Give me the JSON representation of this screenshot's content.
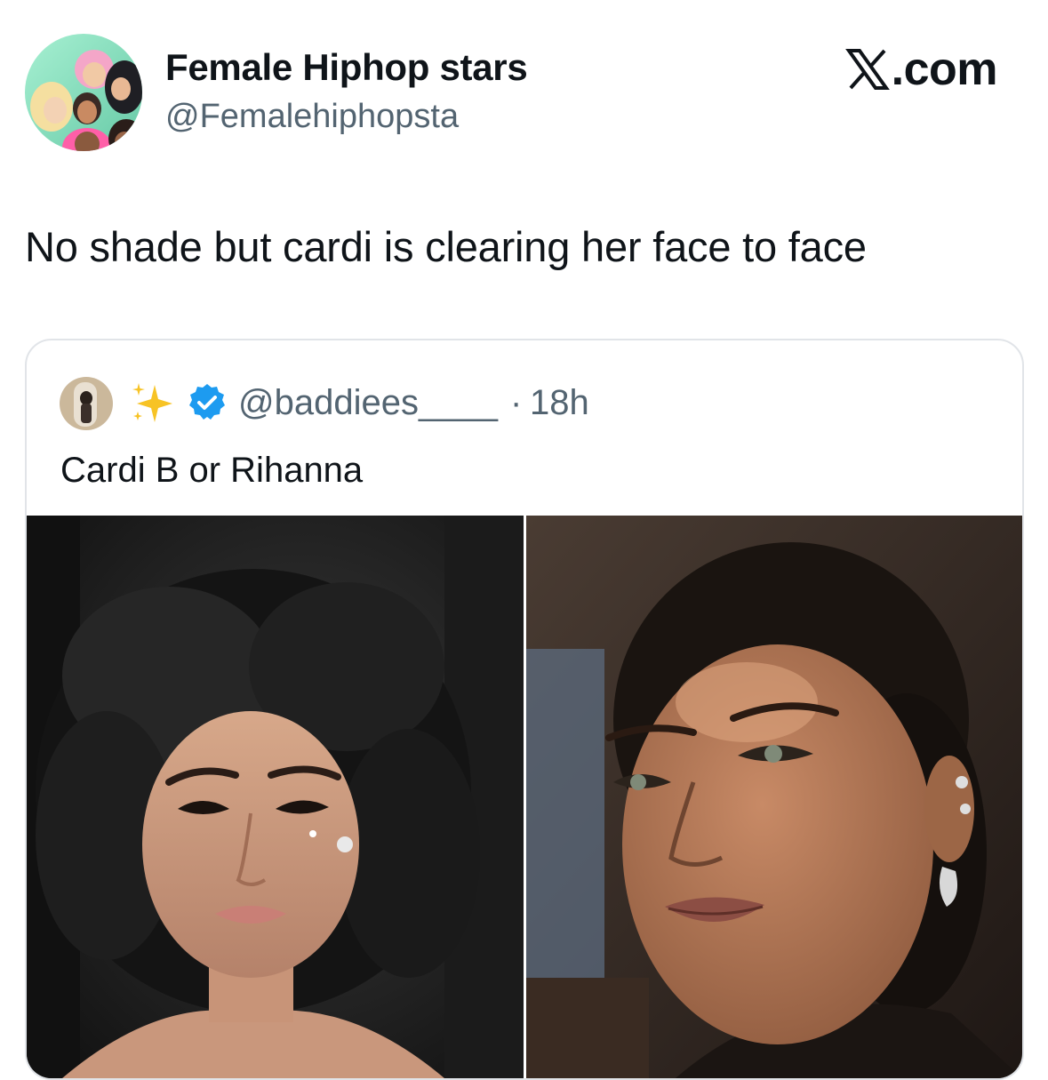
{
  "tweet": {
    "author_name": "Female Hiphop stars",
    "author_handle": "@Femalehiphopsta",
    "brand": ".com",
    "avatar_icon": "cartoon-group-avatar",
    "text": "No shade but cardi is clearing her face to face"
  },
  "quoted_tweet": {
    "handle": "@baddiees____",
    "separator": "·",
    "time": "18h",
    "text": "Cardi B or Rihanna",
    "badge_icon": "verified-badge-icon",
    "emoji_icon": "sparkles-icon",
    "media": [
      {
        "icon": "photo-woman-black-curled-hair"
      },
      {
        "icon": "photo-woman-slicked-back-hair"
      }
    ]
  },
  "colors": {
    "text_primary": "#0f1419",
    "text_secondary": "#536471",
    "verified_blue": "#1d9bf0",
    "card_border": "#e1e4e8",
    "avatar_bg": "#8fe0c0"
  }
}
